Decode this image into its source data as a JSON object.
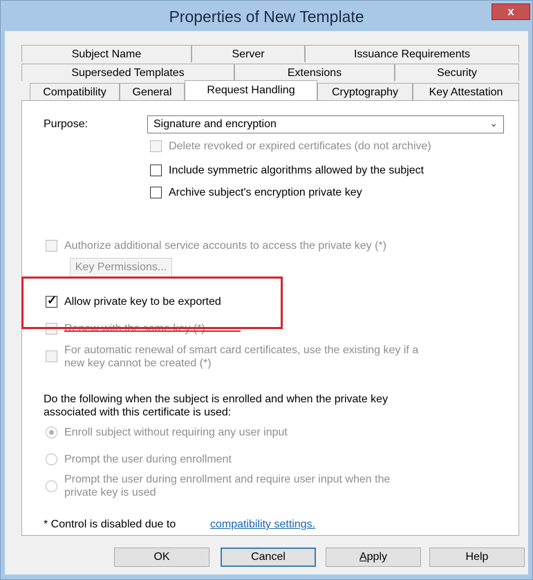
{
  "window": {
    "title": "Properties of New Template",
    "close_glyph": "x"
  },
  "tabs": {
    "row1": [
      "Subject Name",
      "Server",
      "Issuance Requirements"
    ],
    "row2": [
      "Superseded Templates",
      "Extensions",
      "Security"
    ],
    "row3": [
      "Compatibility",
      "General",
      "Request Handling",
      "Cryptography",
      "Key Attestation"
    ],
    "active": "Request Handling"
  },
  "purpose": {
    "label": "Purpose:",
    "selected": "Signature and encryption",
    "chevron_icon": "chevron-down-icon",
    "options": [
      {
        "label": "Delete revoked or expired certificates (do not archive)",
        "checked": false,
        "enabled": false
      },
      {
        "label": "Include symmetric algorithms allowed by the subject",
        "checked": false,
        "enabled": true
      },
      {
        "label": "Archive subject's encryption private key",
        "checked": false,
        "enabled": true
      }
    ]
  },
  "service_accounts": {
    "label": "Authorize additional service accounts to access the private key (*)",
    "checked": false,
    "enabled": false,
    "button": "Key Permissions..."
  },
  "export": {
    "label": "Allow private key to be exported",
    "checked": true
  },
  "renew": {
    "label": "Renew with the same key (*)",
    "checked": false,
    "enabled": false
  },
  "smartcard": {
    "line1": "For automatic renewal of smart card certificates, use the existing key if a",
    "line2": "new key cannot be created (*)",
    "checked": false,
    "enabled": false
  },
  "enrollment": {
    "line1": "Do the following when the subject is enrolled and when the private key",
    "line2": "associated with this certificate is used:",
    "radios": [
      {
        "line1": "Enroll subject without requiring any user input",
        "selected": true
      },
      {
        "line1": "Prompt the user during enrollment",
        "selected": false
      },
      {
        "line1": "Prompt the user during enrollment and require user input when the",
        "line2": "private key is used",
        "selected": false
      }
    ]
  },
  "footnote": {
    "text": "* Control is disabled due to",
    "link": "compatibility settings."
  },
  "buttons": {
    "ok": "OK",
    "cancel": "Cancel",
    "apply_prefix": "",
    "apply_underlined": "A",
    "apply_rest": "pply",
    "help": "Help"
  },
  "colors": {
    "title_bar": "#a9c8e6",
    "close_button": "#c75050",
    "highlight_box": "#d9232d",
    "link": "#1a63b8"
  }
}
